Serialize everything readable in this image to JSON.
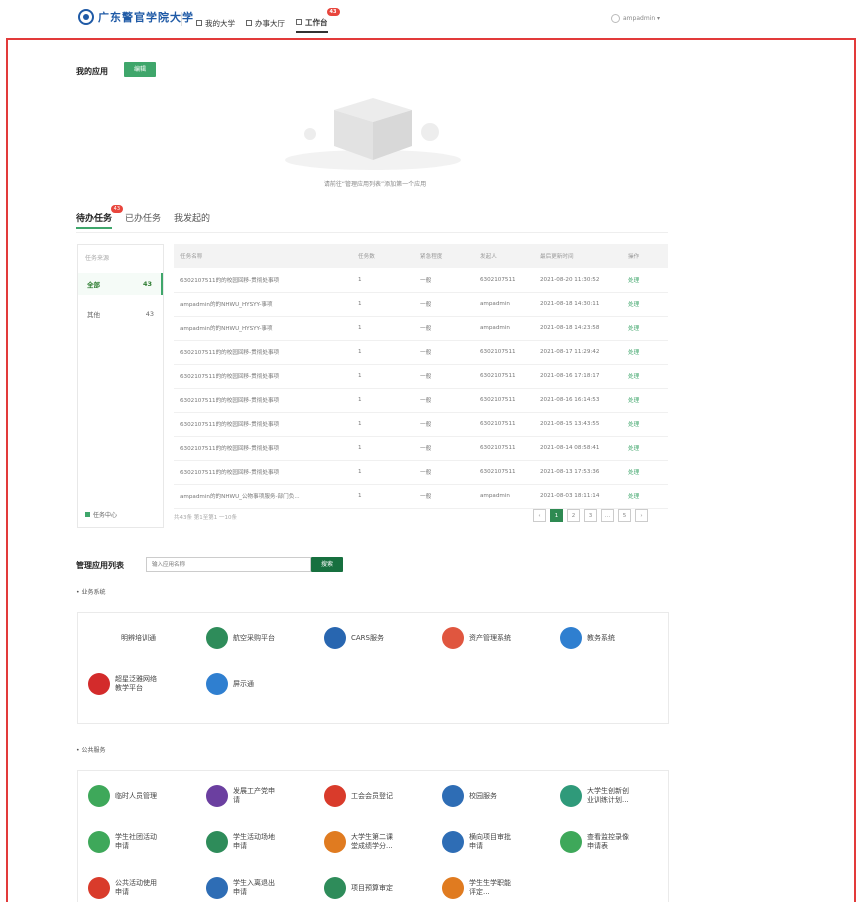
{
  "header": {
    "logo_text": "广东警官学院大学",
    "nav": [
      {
        "label": "我的大学"
      },
      {
        "label": "办事大厅"
      },
      {
        "label": "工作台",
        "badge": "43"
      }
    ],
    "user": "ampadmin ▾"
  },
  "my_apps": {
    "title": "我的应用",
    "edit_label": "编辑",
    "empty_note": "请前往“管理应用列表”添加第一个应用"
  },
  "tasks": {
    "tabs": [
      {
        "label": "待办任务",
        "badge": "43"
      },
      {
        "label": "已办任务"
      },
      {
        "label": "我发起的"
      }
    ],
    "sidebar": {
      "heading": "任务来源",
      "items": [
        {
          "label": "全部",
          "count": "43"
        },
        {
          "label": "其他",
          "count": "43"
        }
      ],
      "footer": "任务中心"
    },
    "columns": [
      "任务名称",
      "任务数",
      "紧急程度",
      "发起人",
      "最后更新时间",
      "操作"
    ],
    "rows": [
      [
        "6302107511的的校园回移-贯彻处事项",
        "1",
        "一般",
        "6302107511",
        "2021-08-20 11:30:52",
        "处理"
      ],
      [
        "ampadmin的的NHWU_HYSYY-事项",
        "1",
        "一般",
        "ampadmin",
        "2021-08-18 14:30:11",
        "处理"
      ],
      [
        "ampadmin的的NHWU_HYSYY-事项",
        "1",
        "一般",
        "ampadmin",
        "2021-08-18 14:23:58",
        "处理"
      ],
      [
        "6302107511的的校园回移-贯彻处事项",
        "1",
        "一般",
        "6302107511",
        "2021-08-17 11:29:42",
        "处理"
      ],
      [
        "6302107511的的校园回移-贯彻处事项",
        "1",
        "一般",
        "6302107511",
        "2021-08-16 17:18:17",
        "处理"
      ],
      [
        "6302107511的的校园回移-贯彻处事项",
        "1",
        "一般",
        "6302107511",
        "2021-08-16 16:14:53",
        "处理"
      ],
      [
        "6302107511的的校园回移-贯彻处事项",
        "1",
        "一般",
        "6302107511",
        "2021-08-15 13:43:55",
        "处理"
      ],
      [
        "6302107511的的校园回移-贯彻处事项",
        "1",
        "一般",
        "6302107511",
        "2021-08-14 08:58:41",
        "处理"
      ],
      [
        "6302107511的的校园回移-贯彻处事项",
        "1",
        "一般",
        "6302107511",
        "2021-08-13 17:53:36",
        "处理"
      ],
      [
        "ampadmin的的NHWU_公物事项服务-部门负...",
        "1",
        "一般",
        "ampadmin",
        "2021-08-03 18:11:14",
        "处理"
      ]
    ],
    "total": "共43条 第1至第1 一10条",
    "pages": [
      "‹",
      "1",
      "2",
      "3",
      "…",
      "5",
      "›"
    ]
  },
  "manage": {
    "title": "管理应用列表",
    "search_placeholder": "输入应用名称",
    "search_btn": "搜索"
  },
  "business": {
    "title": "• 业务系统",
    "apps": [
      {
        "icon": "casah-logo",
        "label": "明辨培训通",
        "color": "#2866b0"
      },
      {
        "icon": "doc-icon",
        "label": "航空采购平台",
        "color": "#2e8c5a"
      },
      {
        "icon": "cars-icon",
        "label": "CARS服务",
        "color": "#2866b0"
      },
      {
        "icon": "grid-icon",
        "label": "资产管理系统",
        "color": "#e0563f"
      },
      {
        "icon": "edu-icon",
        "label": "教务系统",
        "color": "#2f7fd0"
      },
      {
        "icon": "study-icon",
        "label": "超星泛雅网络\n教学平台",
        "color": "#d32b2b"
      },
      {
        "icon": "monitor-icon",
        "label": "屏示通",
        "color": "#2f7fd0"
      }
    ]
  },
  "public": {
    "title": "• 公共服务",
    "apps": [
      {
        "icon": "people-icon",
        "label": "临时人员管理",
        "color": "#3ea85a"
      },
      {
        "icon": "org-icon",
        "label": "发展工产党申\n请",
        "color": "#6b3fa0"
      },
      {
        "icon": "union-icon",
        "label": "工会会员登记",
        "color": "#d93b2b"
      },
      {
        "icon": "campus-icon",
        "label": "校园服务",
        "color": "#2e6db5"
      },
      {
        "icon": "plan-icon",
        "label": "大学生创新创\n业训练计划...",
        "color": "#2f9a7a"
      },
      {
        "icon": "club-icon",
        "label": "学生社团活动\n申请",
        "color": "#3ea85a"
      },
      {
        "icon": "venue-icon",
        "label": "学生活动场地\n申请",
        "color": "#2e8c5a"
      },
      {
        "icon": "class-icon",
        "label": "大学生第二课\n堂成绩学分...",
        "color": "#e07b20"
      },
      {
        "icon": "project-icon",
        "label": "横向项目审批\n申请",
        "color": "#2e6db5"
      },
      {
        "icon": "video-icon",
        "label": "查看监控录像\n申请表",
        "color": "#3ea85a"
      },
      {
        "icon": "event-icon",
        "label": "公共活动使用\n申请",
        "color": "#d93b2b"
      },
      {
        "icon": "enroll-icon",
        "label": "学生入离退出\n申请",
        "color": "#2e6db5"
      },
      {
        "icon": "guide-icon",
        "label": "项目预算审定",
        "color": "#2e8c5a"
      },
      {
        "icon": "award-icon",
        "label": "学生生学职能\n评定...",
        "color": "#e07b20"
      }
    ]
  }
}
